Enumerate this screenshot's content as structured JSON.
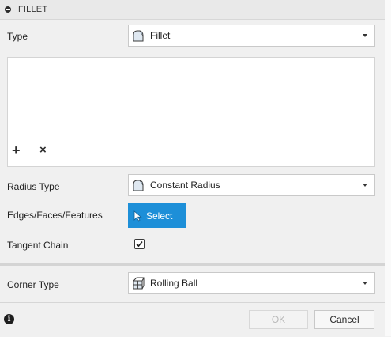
{
  "header": {
    "title": "FILLET",
    "icon": "collapse-icon"
  },
  "type_row": {
    "label": "Type",
    "value": "Fillet",
    "icon": "fillet-shape-icon"
  },
  "selection": {
    "add_symbol": "+",
    "remove_symbol": "×"
  },
  "radius_type_row": {
    "label": "Radius Type",
    "value": "Constant Radius",
    "icon": "constant-radius-icon"
  },
  "edges_row": {
    "label": "Edges/Faces/Features",
    "button_label": "Select",
    "accent": "#1d8fd8"
  },
  "tangent_row": {
    "label": "Tangent Chain",
    "checked": true
  },
  "corner_row": {
    "label": "Corner Type",
    "value": "Rolling Ball",
    "icon": "rolling-ball-icon"
  },
  "footer": {
    "ok_label": "OK",
    "cancel_label": "Cancel",
    "ok_enabled": false
  }
}
